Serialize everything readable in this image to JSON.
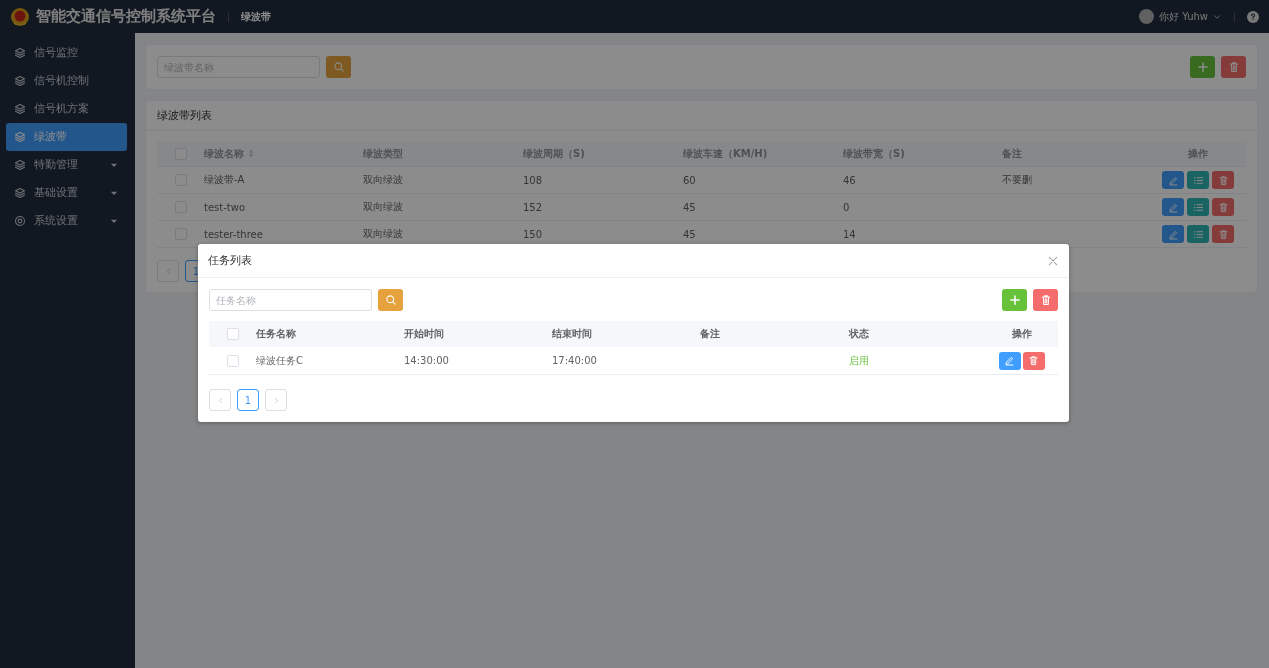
{
  "header": {
    "title": "智能交通信号控制系统平台",
    "breadcrumb": "绿波带",
    "user": "你好 Yuhw"
  },
  "sidebar": {
    "items": [
      {
        "label": "信号监控",
        "kind": "layers",
        "selected": false,
        "submenu": false
      },
      {
        "label": "信号机控制",
        "kind": "layers",
        "selected": false,
        "submenu": false
      },
      {
        "label": "信号机方案",
        "kind": "layers",
        "selected": false,
        "submenu": false
      },
      {
        "label": "绿波带",
        "kind": "layers",
        "selected": true,
        "submenu": false
      },
      {
        "label": "特勤管理",
        "kind": "layers",
        "selected": false,
        "submenu": true
      },
      {
        "label": "基础设置",
        "kind": "layers",
        "selected": false,
        "submenu": true
      },
      {
        "label": "系统设置",
        "kind": "target",
        "selected": false,
        "submenu": true
      }
    ]
  },
  "main": {
    "search": {
      "placeholder": "绿波带名称"
    },
    "panel_title": "绿波带列表",
    "table": {
      "all_checked": false,
      "columns": [
        {
          "label": "绿波名称",
          "sortable": true
        },
        {
          "label": "绿波类型",
          "sortable": false
        },
        {
          "label": "绿波周期（S)",
          "sortable": false
        },
        {
          "label": "绿波车速（KM/H)",
          "sortable": false
        },
        {
          "label": "绿波带宽（S)",
          "sortable": false
        },
        {
          "label": "备注",
          "sortable": false
        },
        {
          "label": "操作",
          "sortable": false
        }
      ],
      "rows": [
        {
          "checked": false,
          "cells": [
            "绿波带-A",
            "双向绿波",
            "108",
            "60",
            "46",
            "不要删"
          ]
        },
        {
          "checked": false,
          "cells": [
            "test-two",
            "双向绿波",
            "152",
            "45",
            "0"
          ]
        },
        {
          "checked": false,
          "cells": [
            "tester-three",
            "双向绿波",
            "150",
            "45",
            "14"
          ]
        }
      ]
    },
    "pagination": {
      "pages": [
        {
          "label": "1",
          "selected": true
        }
      ]
    }
  },
  "dialog": {
    "title": "任务列表",
    "search": {
      "placeholder": "任务名称"
    },
    "table": {
      "all_checked": false,
      "columns": [
        "任务名称",
        "开始时间",
        "结束时间",
        "备注",
        "状态",
        "操作"
      ],
      "rows": [
        {
          "checked": false,
          "name": "绿波任务C",
          "start": "14:30:00",
          "end": "17:40:00",
          "status": "启用",
          "enabled": true
        }
      ]
    },
    "pagination": {
      "pages": [
        {
          "label": "1",
          "selected": true
        }
      ]
    }
  }
}
